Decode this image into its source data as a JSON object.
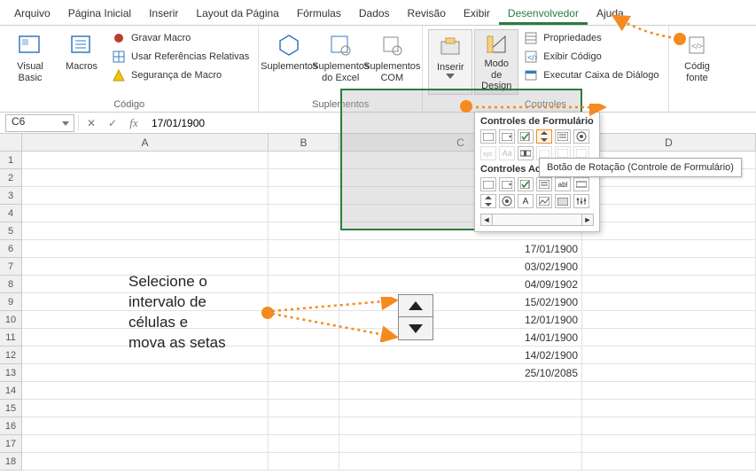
{
  "menu": {
    "items": [
      "Arquivo",
      "Página Inicial",
      "Inserir",
      "Layout da Página",
      "Fórmulas",
      "Dados",
      "Revisão",
      "Exibir",
      "Desenvolvedor",
      "Ajuda"
    ],
    "active": "Desenvolvedor"
  },
  "ribbon": {
    "codigo": {
      "label": "Código",
      "visual_basic": "Visual\nBasic",
      "macros": "Macros",
      "gravar": "Gravar Macro",
      "ref_rel": "Usar Referências Relativas",
      "seguranca": "Segurança de Macro"
    },
    "suplementos_group": {
      "label": "Suplementos",
      "supl": "Suplementos",
      "supl_excel": "Suplementos\ndo Excel",
      "supl_com": "Suplementos\nCOM"
    },
    "controles": {
      "label": "Controles",
      "inserir": "Inserir",
      "modo": "Modo de\nDesign",
      "props": "Propriedades",
      "codigo": "Exibir Código",
      "dialogo": "Executar Caixa de Diálogo"
    },
    "partial": {
      "codigo_fonte": "Códig\nfonte"
    }
  },
  "formula_bar": {
    "name_box": "C6",
    "formula": "17/01/1900"
  },
  "grid": {
    "columns": [
      "A",
      "B",
      "C",
      "D"
    ],
    "rows": [
      "1",
      "2",
      "3",
      "4",
      "5",
      "6",
      "7",
      "8",
      "9",
      "10",
      "11",
      "12",
      "13",
      "14",
      "15",
      "16",
      "17",
      "18"
    ],
    "c_values": {
      "6": "17/01/1900",
      "7": "03/02/1900",
      "8": "04/09/1902",
      "9": "15/02/1900",
      "10": "12/01/1900",
      "11": "14/01/1900",
      "12": "14/02/1900",
      "13": "25/10/2085"
    }
  },
  "controls_dropdown": {
    "section_form": "Controles de Formulário",
    "section_activex": "Controles ActiveX"
  },
  "tooltip": "Botão de Rotação (Controle de Formulário)",
  "annotation": {
    "l1": "Selecione o",
    "l2": "intervalo de",
    "l3": "células e",
    "l4": "mova as setas"
  }
}
